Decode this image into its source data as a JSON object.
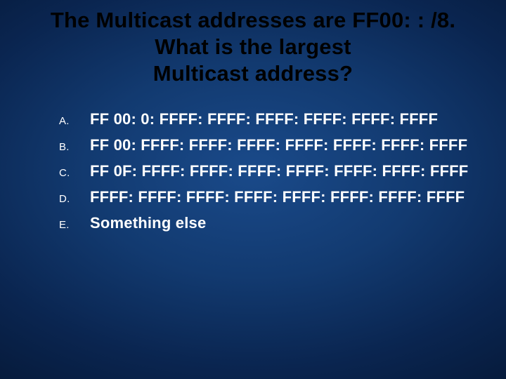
{
  "title": {
    "line1": "The Multicast addresses are FF00: : /8.",
    "line2": "What is the largest",
    "line3": "Multicast address?"
  },
  "options": [
    {
      "letter": "A.",
      "text": "FF 00: 0: FFFF: FFFF: FFFF: FFFF: FFFF: FFFF"
    },
    {
      "letter": "B.",
      "text": "FF 00: FFFF: FFFF: FFFF: FFFF: FFFF: FFFF: FFFF"
    },
    {
      "letter": "C.",
      "text": "FF 0F: FFFF: FFFF: FFFF: FFFF: FFFF: FFFF: FFFF"
    },
    {
      "letter": "D.",
      "text": "FFFF: FFFF: FFFF: FFFF: FFFF: FFFF: FFFF: FFFF"
    },
    {
      "letter": "E.",
      "text": "Something else"
    }
  ]
}
